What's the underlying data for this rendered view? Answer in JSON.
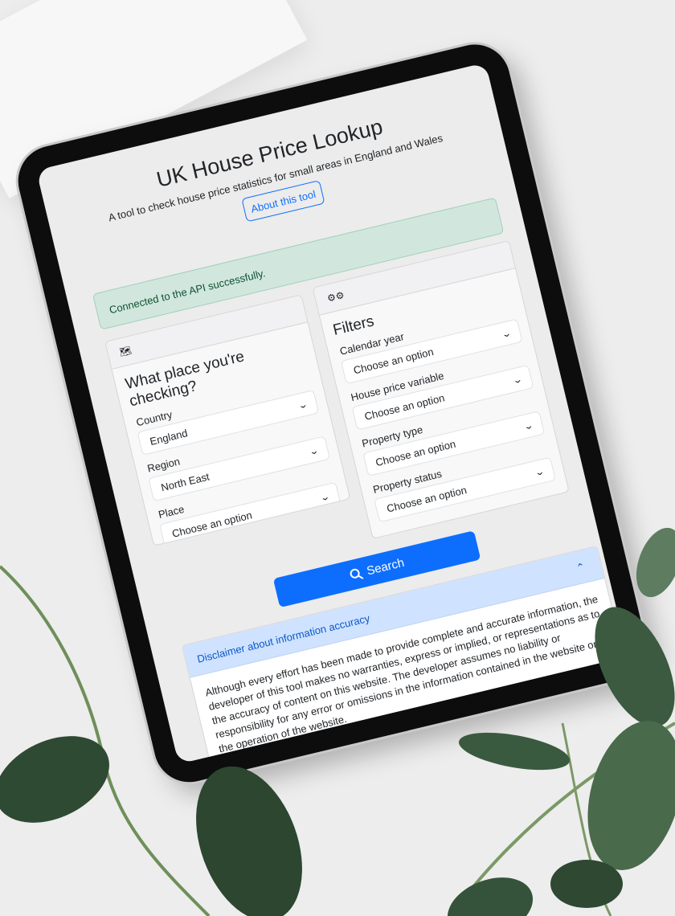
{
  "header": {
    "title": "UK House Price Lookup",
    "subtitle": "A tool to check house price statistics for small areas in England and Wales",
    "about_label": "About this tool"
  },
  "alert": {
    "text": "Connected to the API successfully.",
    "color": "#d1e7dd"
  },
  "place_card": {
    "icon": "map-icon",
    "title": "What place you're checking?",
    "fields": [
      {
        "label": "Country",
        "value": "England"
      },
      {
        "label": "Region",
        "value": "North East"
      },
      {
        "label": "Place",
        "value": "Choose an option"
      }
    ]
  },
  "filters_card": {
    "icon": "gears-icon",
    "title": "Filters",
    "fields": [
      {
        "label": "Calendar year",
        "value": "Choose an option"
      },
      {
        "label": "House price variable",
        "value": "Choose an option"
      },
      {
        "label": "Property type",
        "value": "Choose an option"
      },
      {
        "label": "Property status",
        "value": "Choose an option"
      }
    ]
  },
  "search": {
    "label": "Search",
    "color": "#0d6efd"
  },
  "disclaimer": {
    "title": "Disclaimer about information accuracy",
    "body": "Although every effort has been made to provide complete and accurate information, the developer of this tool makes no warranties, express or implied, or representations as to the accuracy of content on this website. The developer assumes no liability or responsibility for any error or omissions in the information contained in the website or the operation of the website.",
    "expanded": true
  }
}
